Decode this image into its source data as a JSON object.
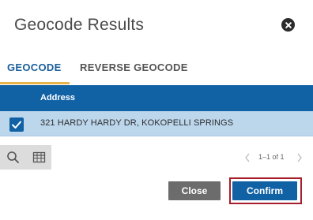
{
  "dialog": {
    "title": "Geocode Results"
  },
  "tabs": [
    {
      "label": "GEOCODE",
      "active": true
    },
    {
      "label": "REVERSE GEOCODE",
      "active": false
    }
  ],
  "table": {
    "columns": [
      "Address"
    ],
    "rows": [
      {
        "address": "321 HARDY HARDY DR, KOKOPELLI SPRINGS",
        "selected": true
      }
    ]
  },
  "pagination": {
    "text": "1–1 of 1"
  },
  "buttons": {
    "close_label": "Close",
    "confirm_label": "Confirm"
  },
  "colors": {
    "accent": "#1161a5",
    "tab_underline": "#e8b44c",
    "selected_row": "#bcd6ec",
    "confirm_outline": "#a71d2a",
    "close_button": "#6c6c6c"
  },
  "icons": {
    "close": "close-circle-icon",
    "checkbox": "checkmark-icon",
    "search": "search-icon",
    "table": "table-icon",
    "prev": "chevron-left-icon",
    "next": "chevron-right-icon"
  }
}
